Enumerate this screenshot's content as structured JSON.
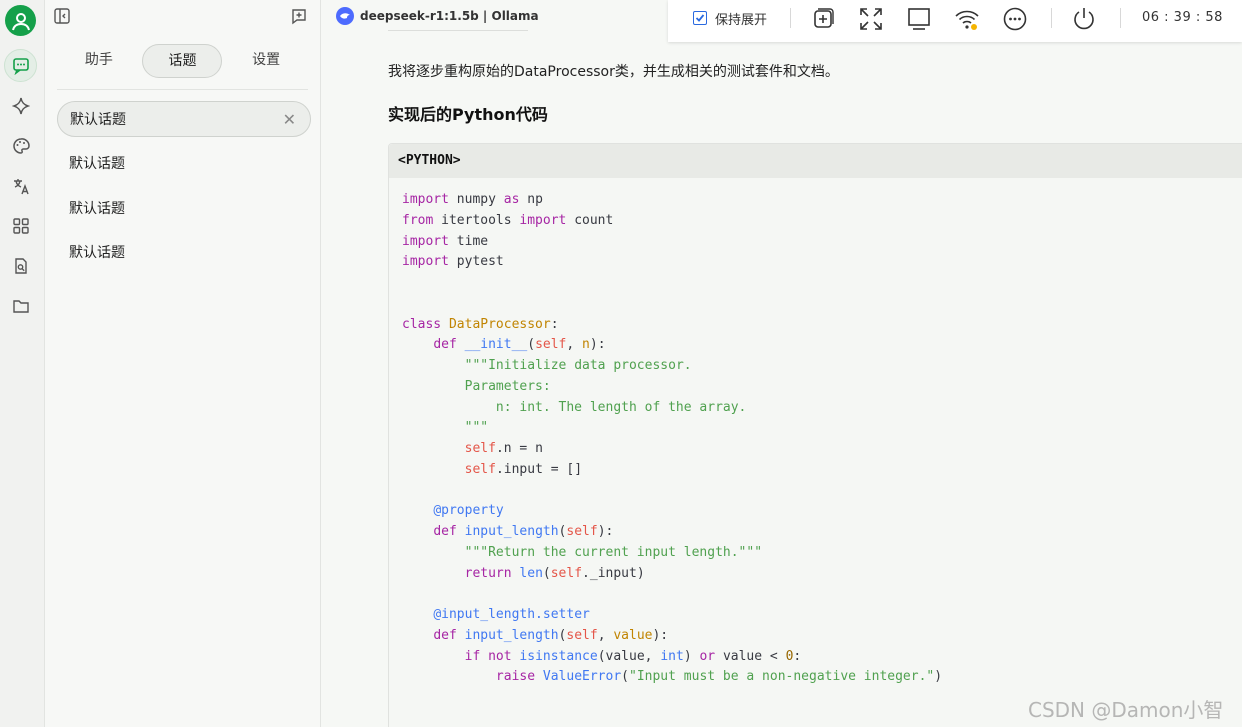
{
  "window": {
    "title": "deepseek-r1:1.5b | Ollama"
  },
  "rail": {
    "items": [
      "chat-icon",
      "sparkle-icon",
      "palette-icon",
      "translate-icon",
      "apps-icon",
      "file-search-icon",
      "folder-icon"
    ]
  },
  "panel": {
    "tabs": [
      {
        "label": "助手"
      },
      {
        "label": "话题"
      },
      {
        "label": "设置"
      }
    ],
    "topics": [
      {
        "label": "默认话题"
      },
      {
        "label": "默认话题"
      },
      {
        "label": "默认话题"
      },
      {
        "label": "默认话题"
      }
    ]
  },
  "message": {
    "intro": "我将逐步重构原始的DataProcessor类，并生成相关的测试套件和文档。",
    "heading": "实现后的Python代码",
    "code_lang": "<PYTHON>",
    "code_lines": [
      "import numpy as np",
      "from itertools import count",
      "import time",
      "import pytest",
      "",
      "",
      "class DataProcessor:",
      "    def __init__(self, n):",
      "        \"\"\"Initialize data processor.",
      "",
      "        Parameters:",
      "            n: int. The length of the array.",
      "        \"\"\"",
      "        self.n = n",
      "        self.input = []",
      "",
      "    @property",
      "    def input_length(self):",
      "        \"\"\"Return the current input length.\"\"\"",
      "        return len(self._input)",
      "",
      "    @input_length.setter",
      "    def input_length(self, value):",
      "        if not isinstance(value, int) or value < 0:",
      "            raise ValueError(\"Input must be a non-negative integer.\")"
    ]
  },
  "sysbar": {
    "keep_expanded_label": "保持展开",
    "keep_expanded_checked": true,
    "clock": "06 : 39 : 58"
  },
  "watermark": "CSDN @Damon小智",
  "colors": {
    "accent": "#15a04a",
    "brand": "#4d6bfe",
    "checkbox": "#2a6ae0"
  }
}
